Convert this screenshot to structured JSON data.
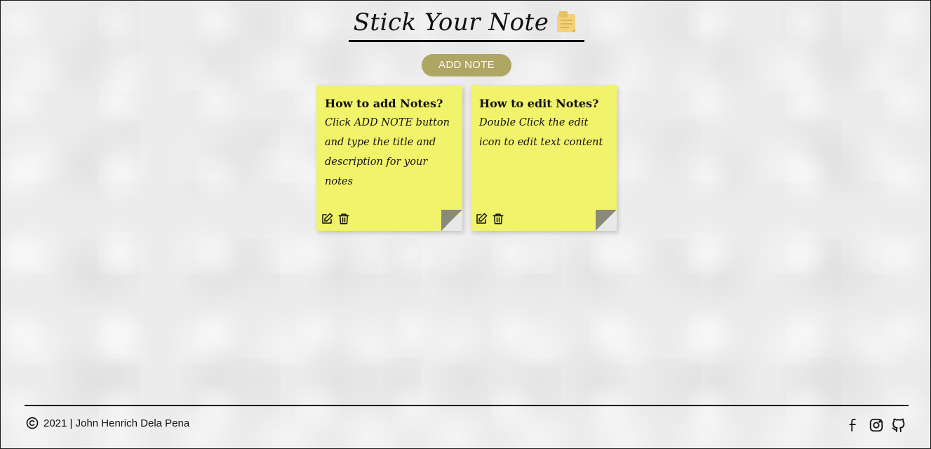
{
  "header": {
    "title": "Stick Your Note",
    "icon": "sticky-note-icon"
  },
  "toolbar": {
    "add_label": "ADD NOTE"
  },
  "notes": [
    {
      "title": "How to add Notes?",
      "description": "Click ADD NOTE button and type the title and description for your notes",
      "edit_icon": "edit-icon",
      "delete_icon": "trash-icon"
    },
    {
      "title": "How to edit Notes?",
      "description": "Double Click the edit icon to edit text content",
      "edit_icon": "edit-icon",
      "delete_icon": "trash-icon"
    }
  ],
  "footer": {
    "copyright_icon": "copyright-icon",
    "text": "2021 | John Henrich Dela Pena",
    "socials": [
      "facebook-icon",
      "instagram-icon",
      "github-icon"
    ]
  },
  "colors": {
    "note_bg": "#f1f36a",
    "button_bg": "#aea663",
    "button_text": "#fbfbf3",
    "text": "#111111"
  }
}
